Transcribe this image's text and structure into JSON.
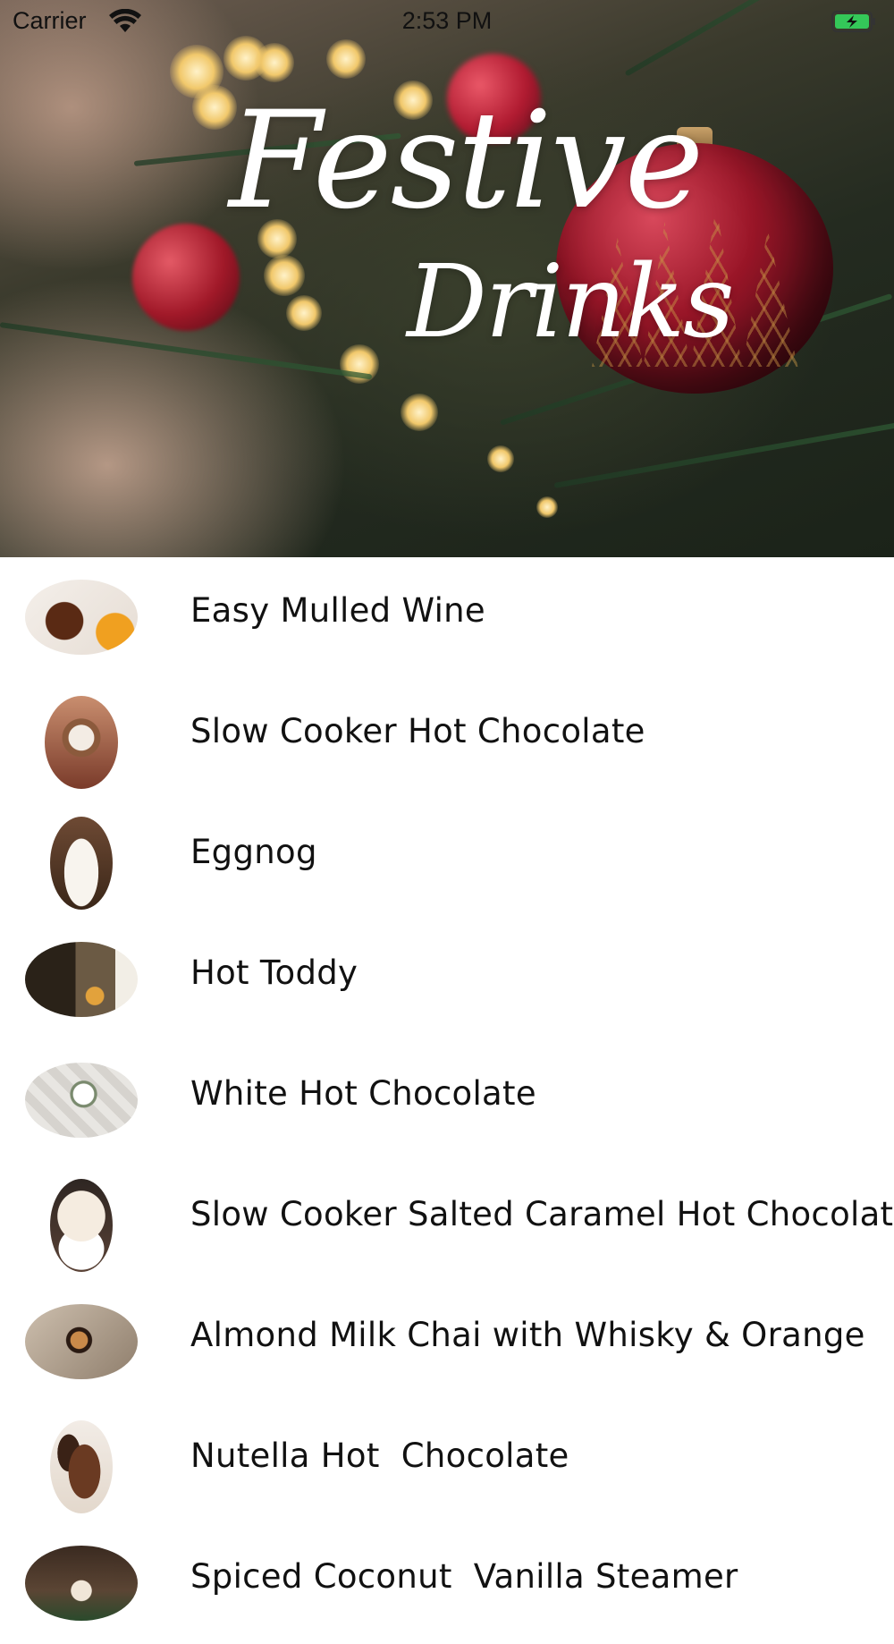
{
  "status_bar": {
    "carrier": "Carrier",
    "time": "2:53 PM",
    "battery_color": "#34c759"
  },
  "header": {
    "title_line1": "Festive",
    "title_line2": "Drinks"
  },
  "drinks": [
    {
      "name": "Easy Mulled Wine",
      "thumb_icon": "mulled-wine-photo"
    },
    {
      "name": "Slow Cooker Hot Chocolate",
      "thumb_icon": "hot-chocolate-photo"
    },
    {
      "name": "Eggnog",
      "thumb_icon": "eggnog-photo"
    },
    {
      "name": "Hot Toddy",
      "thumb_icon": "hot-toddy-photo"
    },
    {
      "name": "White Hot Chocolate",
      "thumb_icon": "white-hot-chocolate-photo"
    },
    {
      "name": "Slow Cooker Salted Caramel Hot Chocolate",
      "thumb_icon": "salted-caramel-photo"
    },
    {
      "name": "Almond Milk Chai with Whisky & Orange",
      "thumb_icon": "chai-photo"
    },
    {
      "name": "Nutella Hot  Chocolate",
      "thumb_icon": "nutella-photo"
    },
    {
      "name": "Spiced Coconut  Vanilla Steamer",
      "thumb_icon": "coconut-steamer-photo"
    }
  ]
}
